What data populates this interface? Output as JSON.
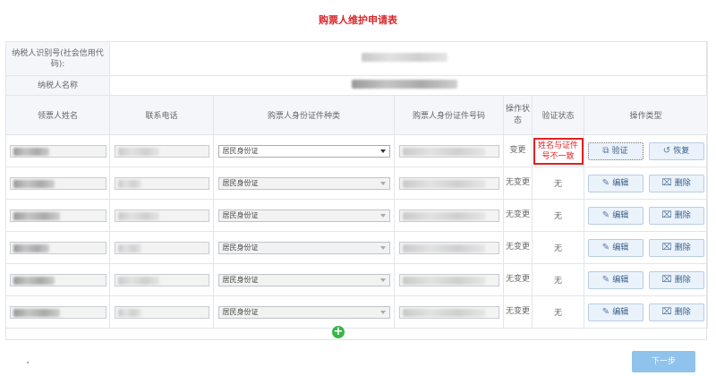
{
  "title": "购票人维护申请表",
  "header": {
    "taxpayer_id_label": "纳税人识别号(社会信用代码):",
    "taxpayer_name_label": "纳税人名称"
  },
  "columns": [
    "领票人姓名",
    "联系电话",
    "购票人身份证件种类",
    "购票人身份证件号码",
    "操作状态",
    "验证状态",
    "操作类型"
  ],
  "rows": [
    {
      "id_type": "居民身份证",
      "op_status": "变更",
      "verify_status": "姓名与证件号不一致",
      "action1": "验证",
      "action2": "恢复",
      "action1_icon": "verify-icon",
      "action2_icon": "restore-icon",
      "editable": true
    },
    {
      "id_type": "居民身份证",
      "op_status": "无变更",
      "verify_status": "无",
      "action1": "编辑",
      "action2": "删除",
      "action1_icon": "edit-icon",
      "action2_icon": "delete-icon",
      "editable": false
    },
    {
      "id_type": "居民身份证",
      "op_status": "无变更",
      "verify_status": "无",
      "action1": "编辑",
      "action2": "删除",
      "action1_icon": "edit-icon",
      "action2_icon": "delete-icon",
      "editable": false
    },
    {
      "id_type": "居民身份证",
      "op_status": "无变更",
      "verify_status": "无",
      "action1": "编辑",
      "action2": "删除",
      "action1_icon": "edit-icon",
      "action2_icon": "delete-icon",
      "editable": false
    },
    {
      "id_type": "居民身份证",
      "op_status": "无变更",
      "verify_status": "无",
      "action1": "编辑",
      "action2": "删除",
      "action1_icon": "edit-icon",
      "action2_icon": "delete-icon",
      "editable": false
    },
    {
      "id_type": "居民身份证",
      "op_status": "无变更",
      "verify_status": "无",
      "action1": "编辑",
      "action2": "删除",
      "action1_icon": "edit-icon",
      "action2_icon": "delete-icon",
      "editable": false
    }
  ],
  "add_button": "+",
  "next_button": "下一步",
  "colors": {
    "title": "#d7262b",
    "error": "#e02020",
    "add": "#3bb54a",
    "next": "#8fc3ec"
  }
}
